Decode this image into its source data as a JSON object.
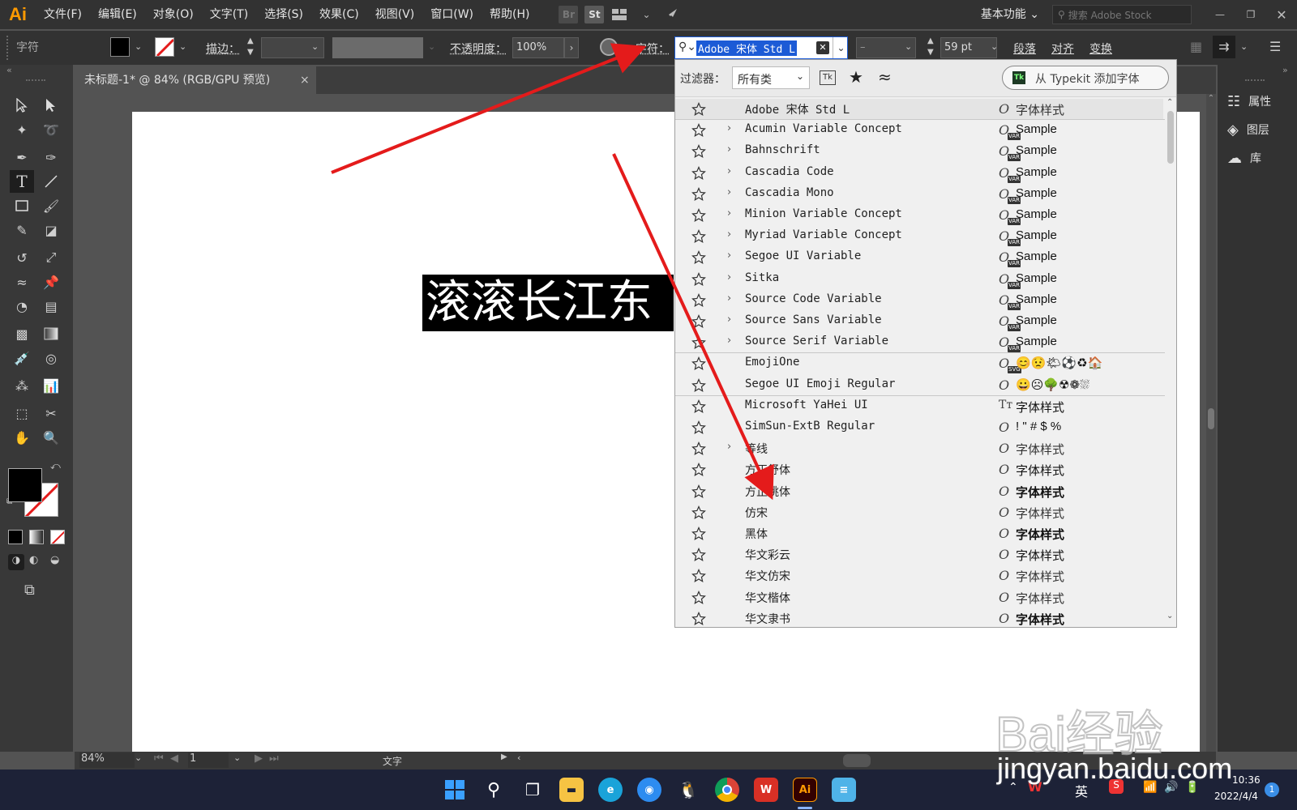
{
  "app": {
    "logo": "Ai"
  },
  "menubar": {
    "items": [
      "文件(F)",
      "编辑(E)",
      "对象(O)",
      "文字(T)",
      "选择(S)",
      "效果(C)",
      "视图(V)",
      "窗口(W)",
      "帮助(H)"
    ],
    "br_label": "Br",
    "st_label": "St",
    "workspace": "基本功能",
    "stock_search_placeholder": "搜索 Adobe Stock"
  },
  "control_bar": {
    "panel_label": "字符",
    "stroke_label": "描边：",
    "opacity_label": "不透明度：",
    "opacity_value": "100%",
    "char_label": "字符：",
    "font_value": "Adobe 宋体 Std L",
    "style_value": "–",
    "size_value": "59 pt",
    "paragraph_label": "段落",
    "align_label": "对齐",
    "transform_label": "变换"
  },
  "document": {
    "tab_title": "未标题-1* @ 84% (RGB/GPU 预览)",
    "artboard_text": "滚滚长江东"
  },
  "font_panel": {
    "filter_label": "过滤器：",
    "filter_value": "所有类",
    "typekit_tk": "Tk",
    "typekit_button": "从 Typekit 添加字体",
    "fonts": [
      {
        "name": "Adobe 宋体 Std L",
        "expandable": false,
        "type": "O",
        "sample": "字体样式",
        "selected": true
      },
      {
        "name": "Acumin Variable Concept",
        "expandable": true,
        "type": "VAR",
        "sample": "Sample"
      },
      {
        "name": "Bahnschrift",
        "expandable": true,
        "type": "VAR",
        "sample": "Sample"
      },
      {
        "name": "Cascadia Code",
        "expandable": true,
        "type": "VAR",
        "sample": "Sample"
      },
      {
        "name": "Cascadia Mono",
        "expandable": true,
        "type": "VAR",
        "sample": "Sample"
      },
      {
        "name": "Minion Variable Concept",
        "expandable": true,
        "type": "VAR",
        "sample": "Sample"
      },
      {
        "name": "Myriad Variable Concept",
        "expandable": true,
        "type": "VAR",
        "sample": "Sample"
      },
      {
        "name": "Segoe UI Variable",
        "expandable": true,
        "type": "VAR",
        "sample": "Sample"
      },
      {
        "name": "Sitka",
        "expandable": true,
        "type": "VAR",
        "sample": "Sample"
      },
      {
        "name": "Source Code Variable",
        "expandable": true,
        "type": "VAR",
        "sample": "Sample"
      },
      {
        "name": "Source Sans Variable",
        "expandable": true,
        "type": "VAR",
        "sample": "Sample"
      },
      {
        "name": "Source Serif Variable",
        "expandable": true,
        "type": "VAR",
        "sample": "Sample"
      },
      {
        "name": "EmojiOne",
        "expandable": false,
        "type": "SVG",
        "sample": "😊😟🌤⚽♻🏠"
      },
      {
        "name": "Segoe UI Emoji Regular",
        "expandable": false,
        "type": "O",
        "sample": "😀☹🌳☢❁⛆"
      },
      {
        "name": "Microsoft YaHei UI",
        "expandable": true,
        "type": "TT",
        "sample": "字体样式"
      },
      {
        "name": "SimSun-ExtB Regular",
        "expandable": false,
        "type": "O",
        "sample": "! \" # $ %"
      },
      {
        "name": "等线",
        "expandable": true,
        "type": "O",
        "sample": "字体样式"
      },
      {
        "name": "方正舒体",
        "expandable": false,
        "type": "O",
        "sample": "字体样式"
      },
      {
        "name": "方正姚体",
        "expandable": false,
        "type": "O",
        "sample": "字体样式"
      },
      {
        "name": "仿宋",
        "expandable": false,
        "type": "O",
        "sample": "字体样式"
      },
      {
        "name": "黑体",
        "expandable": false,
        "type": "O",
        "sample": "字体样式"
      },
      {
        "name": "华文彩云",
        "expandable": false,
        "type": "O",
        "sample": "字体样式"
      },
      {
        "name": "华文仿宋",
        "expandable": false,
        "type": "O",
        "sample": "字体样式"
      },
      {
        "name": "华文楷体",
        "expandable": false,
        "type": "O",
        "sample": "字体样式"
      },
      {
        "name": "华文隶书",
        "expandable": false,
        "type": "O",
        "sample": "字体样式"
      }
    ]
  },
  "right_panel": {
    "items": [
      "属性",
      "图层",
      "库"
    ]
  },
  "status_bar": {
    "zoom": "84%",
    "page": "1",
    "tool_name": "文字"
  },
  "taskbar": {
    "ime": "英",
    "time": "10:36",
    "date": "2022/4/4",
    "notification_count": "1"
  },
  "watermark": {
    "text": "Bai经验",
    "url": "jingyan.baidu.com"
  },
  "colors": {
    "accent_orange": "#ff9a00",
    "arrow_red": "#e41b1b",
    "selection_blue": "#1c5bd6"
  }
}
